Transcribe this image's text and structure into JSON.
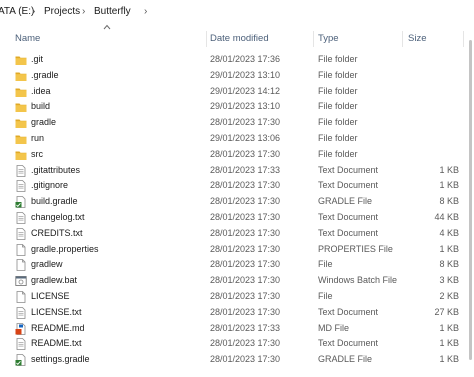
{
  "address": {
    "drive": "ATA (E:)",
    "folder1": "Projects",
    "folder2": "Butterfly",
    "separator": "›"
  },
  "columns": {
    "name": "Name",
    "date": "Date modified",
    "type": "Type",
    "size": "Size"
  },
  "files": [
    {
      "name": ".git",
      "date": "28/01/2023 17:36",
      "type": "File folder",
      "size": "",
      "icon": "folder-icon"
    },
    {
      "name": ".gradle",
      "date": "29/01/2023 13:10",
      "type": "File folder",
      "size": "",
      "icon": "folder-icon"
    },
    {
      "name": ".idea",
      "date": "29/01/2023 14:12",
      "type": "File folder",
      "size": "",
      "icon": "folder-icon"
    },
    {
      "name": "build",
      "date": "29/01/2023 13:10",
      "type": "File folder",
      "size": "",
      "icon": "folder-icon"
    },
    {
      "name": "gradle",
      "date": "28/01/2023 17:30",
      "type": "File folder",
      "size": "",
      "icon": "folder-icon"
    },
    {
      "name": "run",
      "date": "29/01/2023 13:06",
      "type": "File folder",
      "size": "",
      "icon": "folder-icon"
    },
    {
      "name": "src",
      "date": "28/01/2023 17:30",
      "type": "File folder",
      "size": "",
      "icon": "folder-icon"
    },
    {
      "name": ".gitattributes",
      "date": "28/01/2023 17:33",
      "type": "Text Document",
      "size": "1 KB",
      "icon": "text-file-icon"
    },
    {
      "name": ".gitignore",
      "date": "28/01/2023 17:30",
      "type": "Text Document",
      "size": "1 KB",
      "icon": "text-file-icon"
    },
    {
      "name": "build.gradle",
      "date": "28/01/2023 17:30",
      "type": "GRADLE File",
      "size": "8 KB",
      "icon": "gradle-file-icon"
    },
    {
      "name": "changelog.txt",
      "date": "28/01/2023 17:30",
      "type": "Text Document",
      "size": "44 KB",
      "icon": "text-file-icon"
    },
    {
      "name": "CREDITS.txt",
      "date": "28/01/2023 17:30",
      "type": "Text Document",
      "size": "4 KB",
      "icon": "text-file-icon"
    },
    {
      "name": "gradle.properties",
      "date": "28/01/2023 17:30",
      "type": "PROPERTIES File",
      "size": "1 KB",
      "icon": "blank-file-icon"
    },
    {
      "name": "gradlew",
      "date": "28/01/2023 17:30",
      "type": "File",
      "size": "8 KB",
      "icon": "blank-file-icon"
    },
    {
      "name": "gradlew.bat",
      "date": "28/01/2023 17:30",
      "type": "Windows Batch File",
      "size": "3 KB",
      "icon": "batch-file-icon"
    },
    {
      "name": "LICENSE",
      "date": "28/01/2023 17:30",
      "type": "File",
      "size": "2 KB",
      "icon": "blank-file-icon"
    },
    {
      "name": "LICENSE.txt",
      "date": "28/01/2023 17:30",
      "type": "Text Document",
      "size": "27 KB",
      "icon": "text-file-icon"
    },
    {
      "name": "README.md",
      "date": "28/01/2023 17:33",
      "type": "MD File",
      "size": "1 KB",
      "icon": "md-file-icon"
    },
    {
      "name": "README.txt",
      "date": "28/01/2023 17:30",
      "type": "Text Document",
      "size": "1 KB",
      "icon": "text-file-icon"
    },
    {
      "name": "settings.gradle",
      "date": "28/01/2023 17:30",
      "type": "GRADLE File",
      "size": "1 KB",
      "icon": "gradle-file-icon"
    }
  ],
  "colors": {
    "folder": "#f3c54b",
    "folder_dark": "#e0a926",
    "header_text": "#4c607a"
  }
}
